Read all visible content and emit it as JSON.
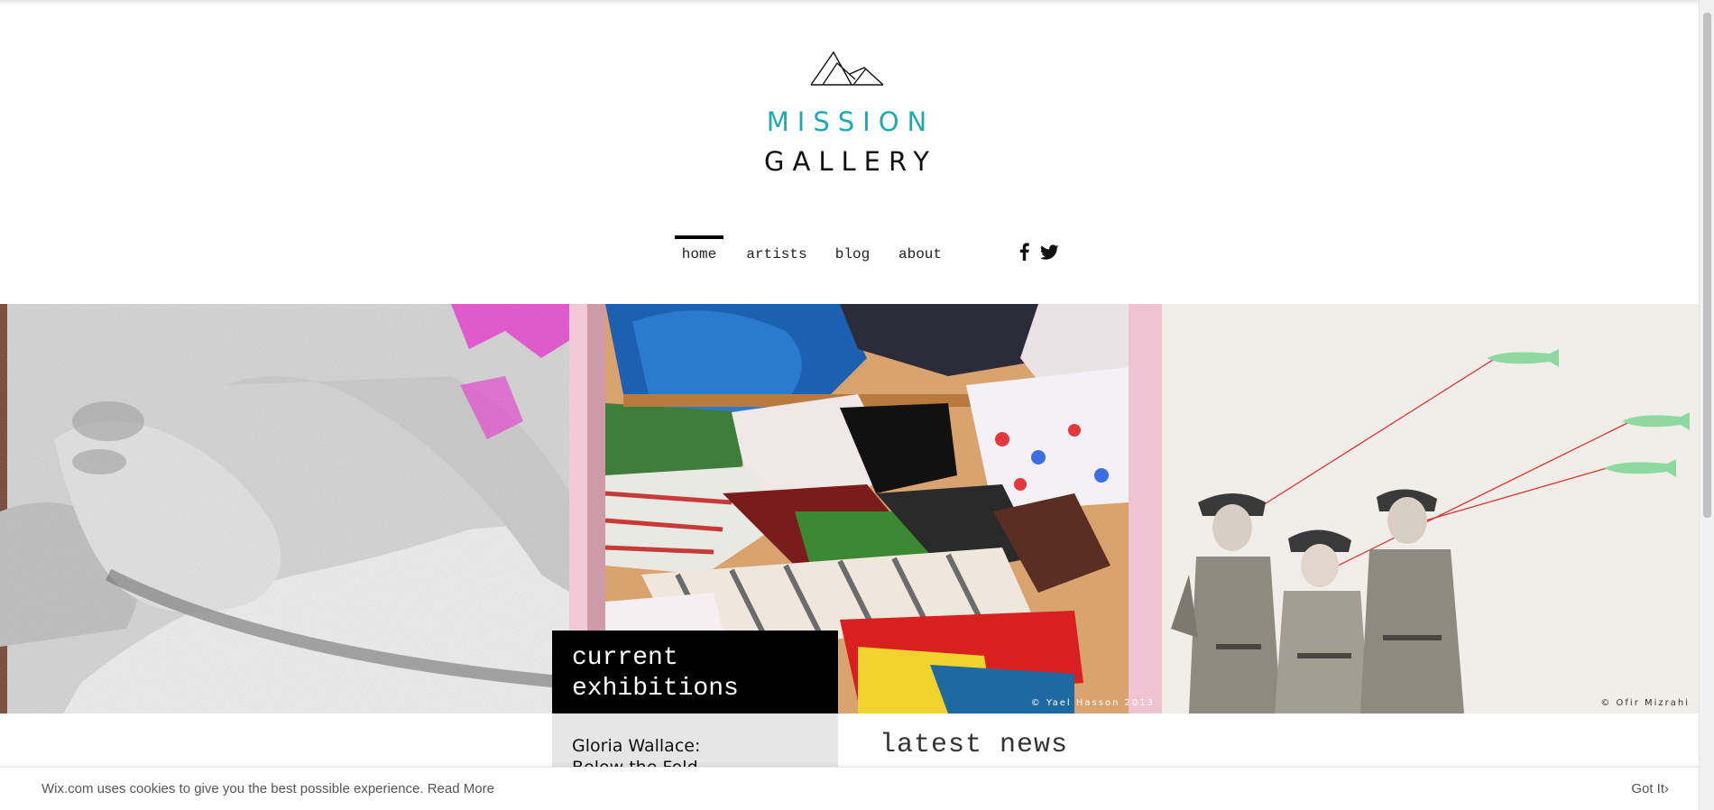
{
  "brand": {
    "line1": "MISSION",
    "line2": "GALLERY",
    "accent_color": "#21a9ad",
    "logo_icon": "mountain-logo-icon"
  },
  "nav": {
    "items": [
      {
        "label": "home",
        "active": true
      },
      {
        "label": "artists",
        "active": false
      },
      {
        "label": "blog",
        "active": false
      },
      {
        "label": "about",
        "active": false
      }
    ],
    "social": [
      "facebook-icon",
      "twitter-icon"
    ]
  },
  "gallery": {
    "artworks": [
      {
        "name": "grayscale-figure-artwork",
        "credit": ""
      },
      {
        "name": "painted-clothes-pile-artwork",
        "credit": "© Yael Hasson 2013"
      },
      {
        "name": "girl-scouts-kites-collage-artwork",
        "credit": "© Ofir Mizrahi"
      }
    ]
  },
  "current_exhibitions": {
    "title_line1": "current",
    "title_line2": "exhibitions",
    "item_line1": "Gloria Wallace:",
    "item_line2": "Below the Fold"
  },
  "news": {
    "title": "latest news"
  },
  "cookie": {
    "text": "Wix.com uses cookies to give you the best possible experience.",
    "link": "Read More",
    "button": "Got It",
    "button_icon": "chevron-right-icon"
  }
}
